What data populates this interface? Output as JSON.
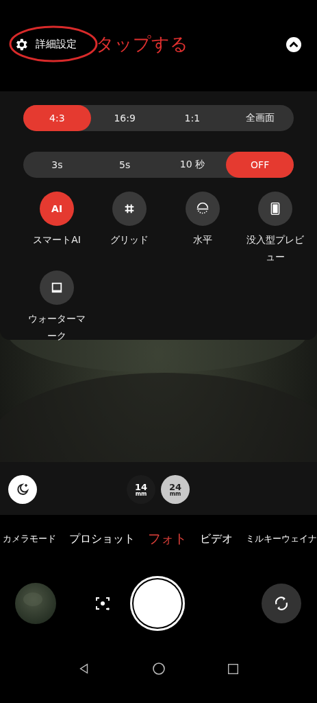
{
  "header": {
    "settings_label": "詳細設定",
    "annotation": "タップする"
  },
  "aspect_ratios": [
    {
      "label": "4:3",
      "selected": true
    },
    {
      "label": "16:9",
      "selected": false
    },
    {
      "label": "1:1",
      "selected": false
    },
    {
      "label": "全画面",
      "selected": false
    }
  ],
  "timers": [
    {
      "label": "3s",
      "selected": false
    },
    {
      "label": "5s",
      "selected": false
    },
    {
      "label": "10 秒",
      "selected": false
    },
    {
      "label": "OFF",
      "selected": true
    }
  ],
  "features": [
    {
      "kind": "text",
      "glyph": "AI",
      "label": "スマートAI",
      "on": true
    },
    {
      "kind": "grid",
      "label": "グリッド",
      "on": false
    },
    {
      "kind": "level",
      "label": "水平",
      "on": false
    },
    {
      "kind": "immersive",
      "label": "没入型プレビュー",
      "on": false
    },
    {
      "kind": "watermark",
      "label": "ウォーターマーク",
      "on": false
    }
  ],
  "lenses": [
    {
      "value": "14",
      "unit": "mm",
      "selected": false
    },
    {
      "value": "24",
      "unit": "mm",
      "selected": true
    }
  ],
  "modes": [
    {
      "label": "カメラモード",
      "selected": false
    },
    {
      "label": "プロショット",
      "selected": false
    },
    {
      "label": "フォト",
      "selected": true
    },
    {
      "label": "ビデオ",
      "selected": false
    },
    {
      "label": "ミルキーウェイナ",
      "selected": false
    }
  ]
}
